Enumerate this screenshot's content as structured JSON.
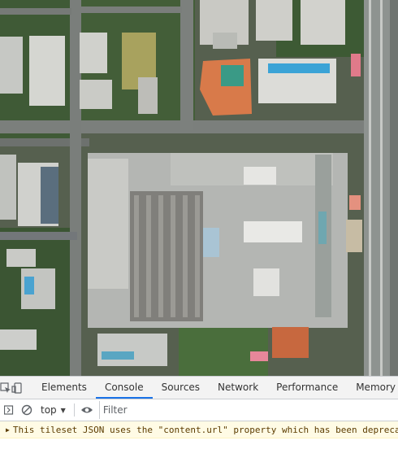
{
  "devtools": {
    "tabs": [
      {
        "label": "Elements",
        "active": false
      },
      {
        "label": "Console",
        "active": true
      },
      {
        "label": "Sources",
        "active": false
      },
      {
        "label": "Network",
        "active": false
      },
      {
        "label": "Performance",
        "active": false
      },
      {
        "label": "Memory",
        "active": false
      }
    ],
    "icons": {
      "inspect": "inspect-element-icon",
      "device": "device-toolbar-icon",
      "sidebar": "console-sidebar-icon",
      "clear": "clear-console-icon",
      "eye": "live-expression-icon"
    },
    "toolbar": {
      "context": "top",
      "filter_placeholder": "Filter"
    },
    "messages": [
      {
        "level": "warning",
        "text": "This tileset JSON uses the \"content.url\" property which has been depreca"
      }
    ],
    "accent": "#1a73e8"
  },
  "map": {
    "type": "aerial-3d-tileset"
  }
}
